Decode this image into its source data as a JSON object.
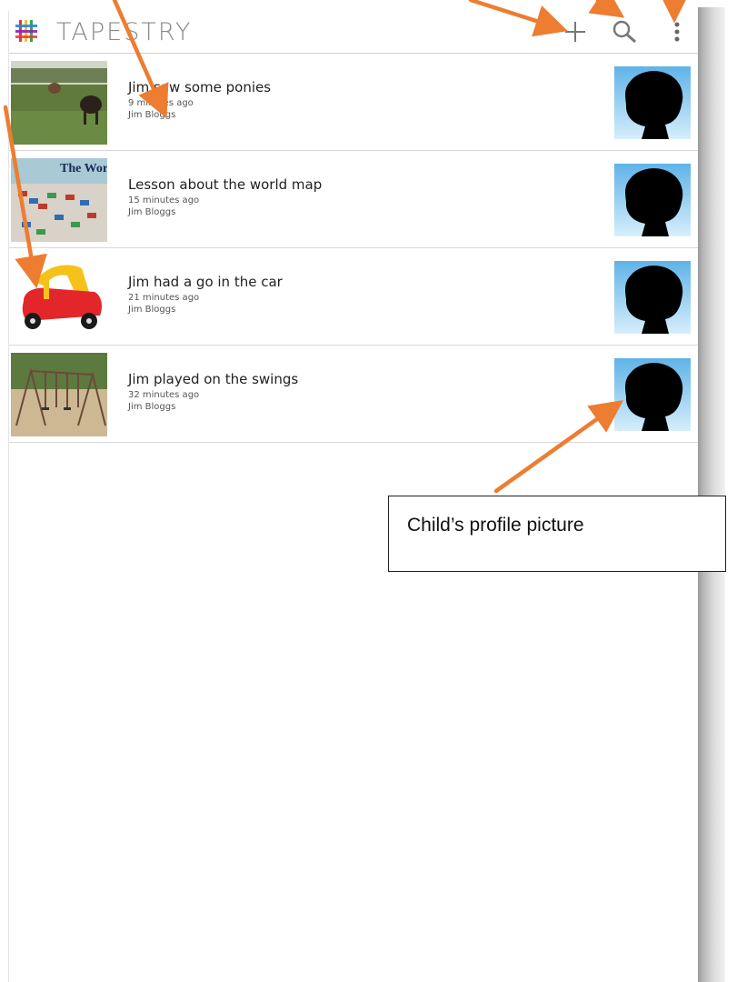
{
  "app": {
    "title": "TAPESTRY",
    "logo_icon": "tapestry-hash-logo",
    "actions": {
      "add_icon": "plus-icon",
      "search_icon": "search-icon",
      "overflow_icon": "overflow-menu-icon"
    }
  },
  "observations": [
    {
      "title": "Jim saw some ponies",
      "time": "9 minutes ago",
      "author": "Jim Bloggs",
      "thumbnail": "ponies-photo"
    },
    {
      "title": "Lesson about the world map",
      "time": "15 minutes ago",
      "author": "Jim Bloggs",
      "thumbnail": "world-map-photo",
      "thumbnail_caption": "The World"
    },
    {
      "title": "Jim had a go in the car",
      "time": "21 minutes ago",
      "author": "Jim Bloggs",
      "thumbnail": "toy-car-photo"
    },
    {
      "title": "Jim played on the swings",
      "time": "32 minutes ago",
      "author": "Jim Bloggs",
      "thumbnail": "swings-photo"
    }
  ],
  "annotation": {
    "callout_text": "Child’s profile picture"
  },
  "colors": {
    "arrow": "#ED7D31",
    "avatar_bg": "#8FCBEF",
    "logo": [
      "#E53935",
      "#FBC02D",
      "#43A047",
      "#1E88E5",
      "#8E24AA"
    ]
  }
}
